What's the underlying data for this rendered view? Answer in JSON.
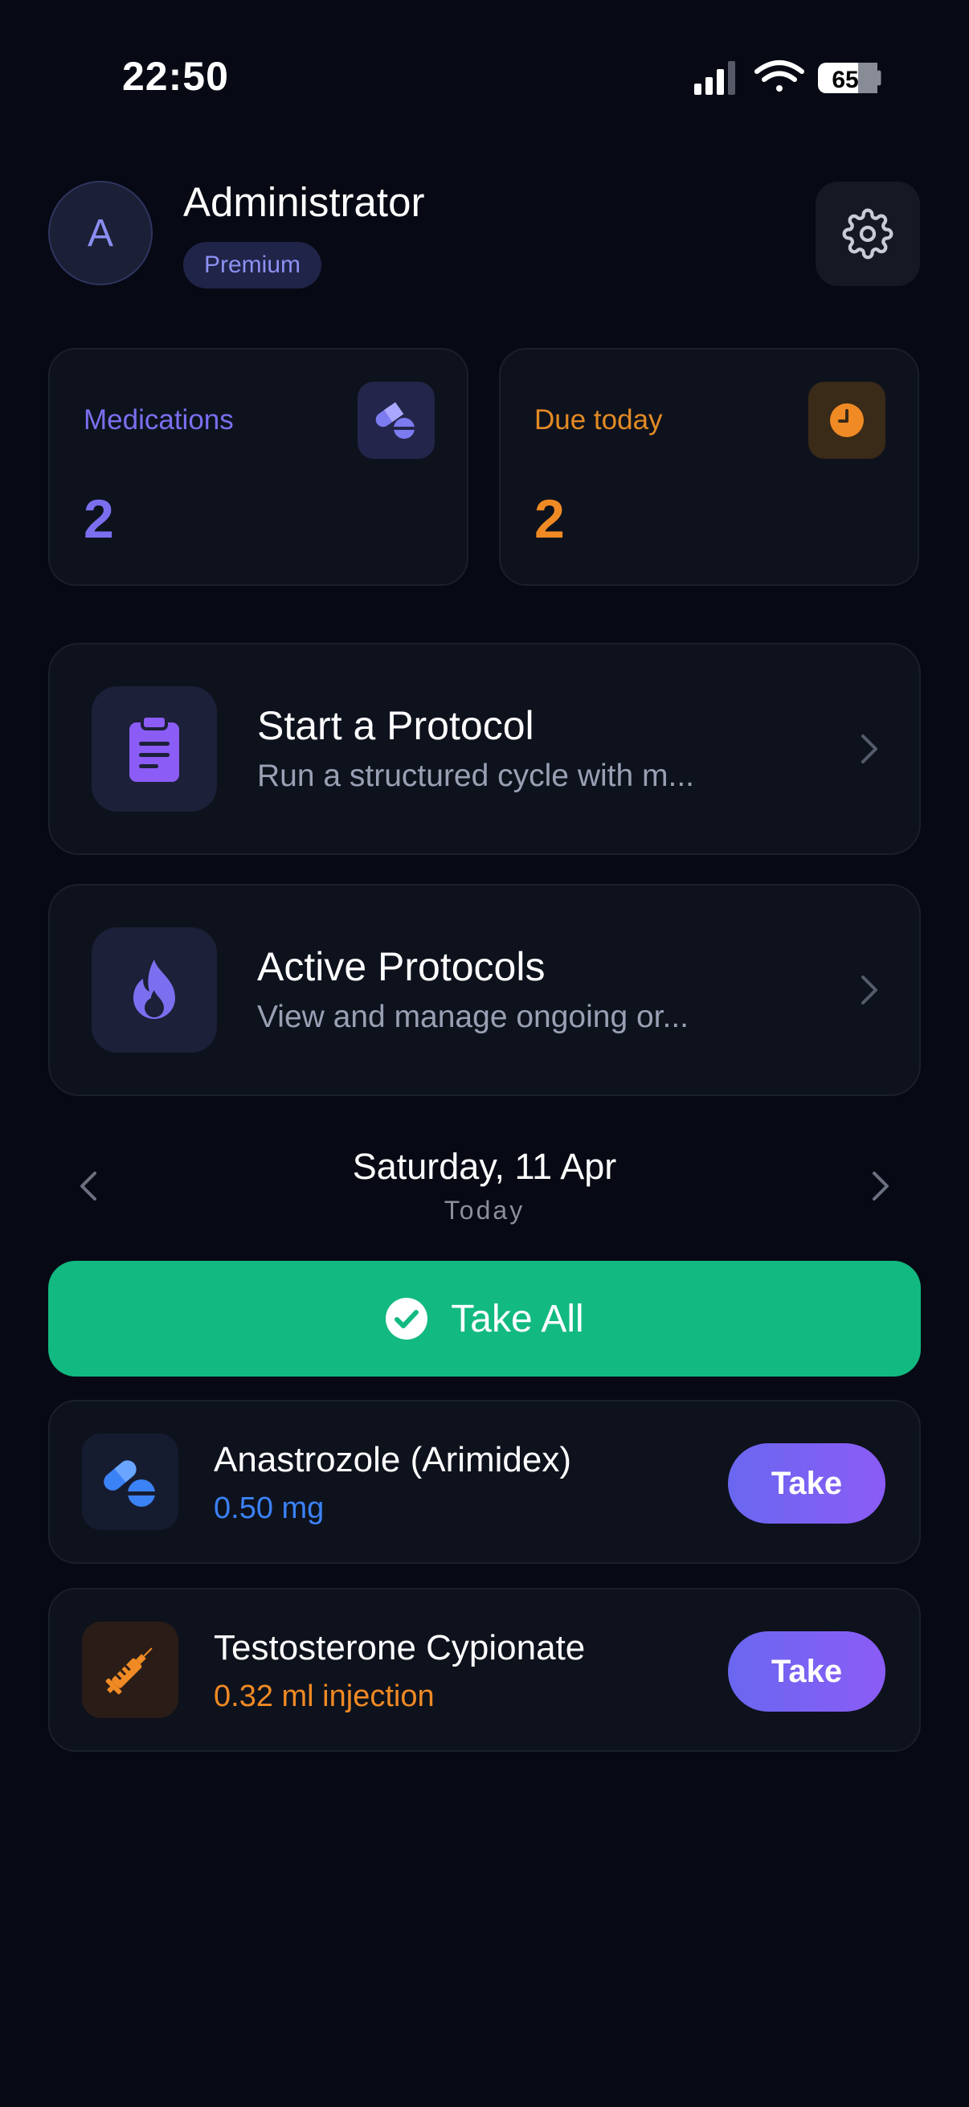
{
  "status_bar": {
    "time": "22:50",
    "battery": "65"
  },
  "header": {
    "username": "Administrator",
    "avatar_letter": "A",
    "badge": "Premium",
    "settings_icon": "gear-icon"
  },
  "stats": [
    {
      "label": "Medications",
      "value": "2",
      "color": "#7b6ff0",
      "icon": "pills-icon"
    },
    {
      "label": "Due today",
      "value": "2",
      "color": "#f08a24",
      "icon": "clock-icon"
    }
  ],
  "protocols": [
    {
      "title": "Start a Protocol",
      "subtitle": "Run a structured cycle with m...",
      "icon": "clipboard-icon"
    },
    {
      "title": "Active Protocols",
      "subtitle": "View and manage ongoing or...",
      "icon": "flame-icon"
    }
  ],
  "date_nav": {
    "date": "Saturday, 11 Apr",
    "label": "Today"
  },
  "take_all": {
    "label": "Take All",
    "color": "#12b981"
  },
  "medications": [
    {
      "name": "Anastrozole (Arimidex)",
      "dose": "0.50 mg",
      "dose_color": "#3b82f6",
      "icon": "pills-icon",
      "action": "Take"
    },
    {
      "name": "Testosterone Cypionate",
      "dose": "0.32 ml injection",
      "dose_color": "#f08a24",
      "icon": "syringe-icon",
      "action": "Take"
    }
  ]
}
